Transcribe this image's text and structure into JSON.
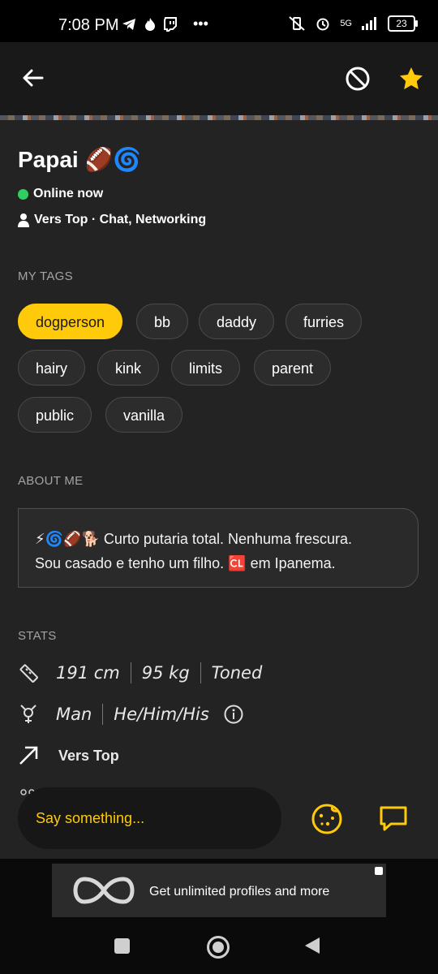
{
  "status_bar": {
    "time": "7:08 PM",
    "network": "5G",
    "battery": "23"
  },
  "profile": {
    "name": "Papai 🏈🌀",
    "online_status": "Online now",
    "role_line": "Vers Top · Chat, Networking"
  },
  "tags_section": {
    "heading": "MY TAGS",
    "tags": [
      "dogperson",
      "bb",
      "daddy",
      "furries",
      "hairy",
      "kink",
      "limits",
      "parent",
      "public",
      "vanilla"
    ],
    "selected": "dogperson"
  },
  "about_section": {
    "heading": "ABOUT ME",
    "line1": "⚡🌀🏈🐕 Curto putaria total. Nenhuma frescura.",
    "line2": "Sou casado e tenho um filho. 🆑 em Ipanema."
  },
  "stats_section": {
    "heading": "STATS",
    "height": "191 cm",
    "weight": "95 kg",
    "body_type": "Toned",
    "gender": "Man",
    "pronouns": "He/Him/His",
    "position": "Vers Top"
  },
  "chat": {
    "placeholder": "Say something..."
  },
  "ad": {
    "text": "Get unlimited profiles and more"
  },
  "colors": {
    "accent": "#ffca0a",
    "online": "#2ed15f",
    "background": "#232323"
  }
}
